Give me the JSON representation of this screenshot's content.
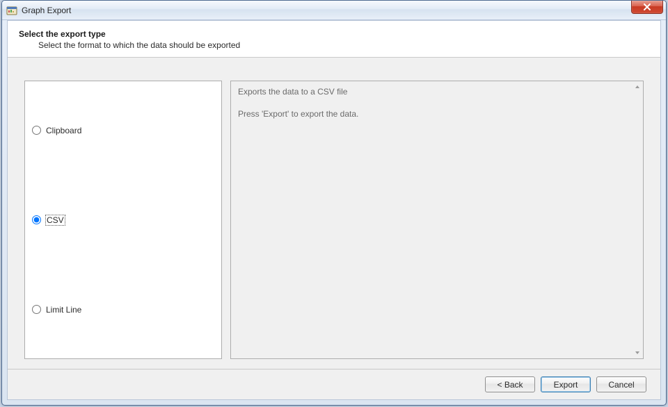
{
  "window": {
    "title": "Graph Export"
  },
  "header": {
    "title": "Select the export type",
    "subtitle": "Select the format to which the data should be exported"
  },
  "options": {
    "items": [
      {
        "label": "Clipboard",
        "selected": false
      },
      {
        "label": "CSV",
        "selected": true
      },
      {
        "label": "Limit Line",
        "selected": false
      }
    ]
  },
  "description": {
    "line1": "Exports the data to a CSV file",
    "line2": "Press 'Export' to export the data."
  },
  "buttons": {
    "back": "< Back",
    "export": "Export",
    "cancel": "Cancel"
  }
}
